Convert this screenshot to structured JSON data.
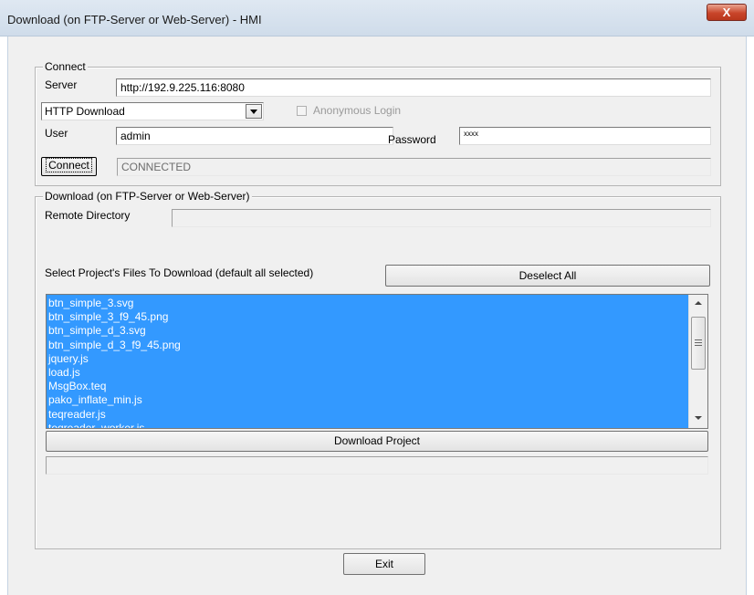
{
  "window": {
    "title": "Download (on FTP-Server or Web-Server) - HMI",
    "close_glyph": "X"
  },
  "connect": {
    "legend": "Connect",
    "server_label": "Server",
    "server_value": "http://192.9.225.116:8080",
    "protocol_selected": "HTTP Download",
    "anonymous_label": "Anonymous Login",
    "anonymous_checked": false,
    "user_label": "User",
    "user_value": "admin",
    "password_label": "Password",
    "password_value": "xxxx",
    "connect_button": "Connect",
    "status": "CONNECTED"
  },
  "download": {
    "legend": "Download (on FTP-Server or Web-Server)",
    "remote_dir_label": "Remote Directory",
    "remote_dir_value": "",
    "select_label": "Select Project's Files To Download (default all selected)",
    "deselect_button": "Deselect All",
    "files": [
      "btn_simple_3.svg",
      "btn_simple_3_f9_45.png",
      "btn_simple_d_3.svg",
      "btn_simple_d_3_f9_45.png",
      "jquery.js",
      "load.js",
      "MsgBox.teq",
      "pako_inflate_min.js",
      "teqreader.js",
      "teqreader_worker.js"
    ],
    "download_button": "Download Project",
    "progress": 0
  },
  "exit_button": "Exit",
  "icons": [
    "close-icon",
    "dropdown-arrow-icon",
    "scroll-up-icon",
    "scroll-down-icon",
    "scroll-grip-icon"
  ]
}
